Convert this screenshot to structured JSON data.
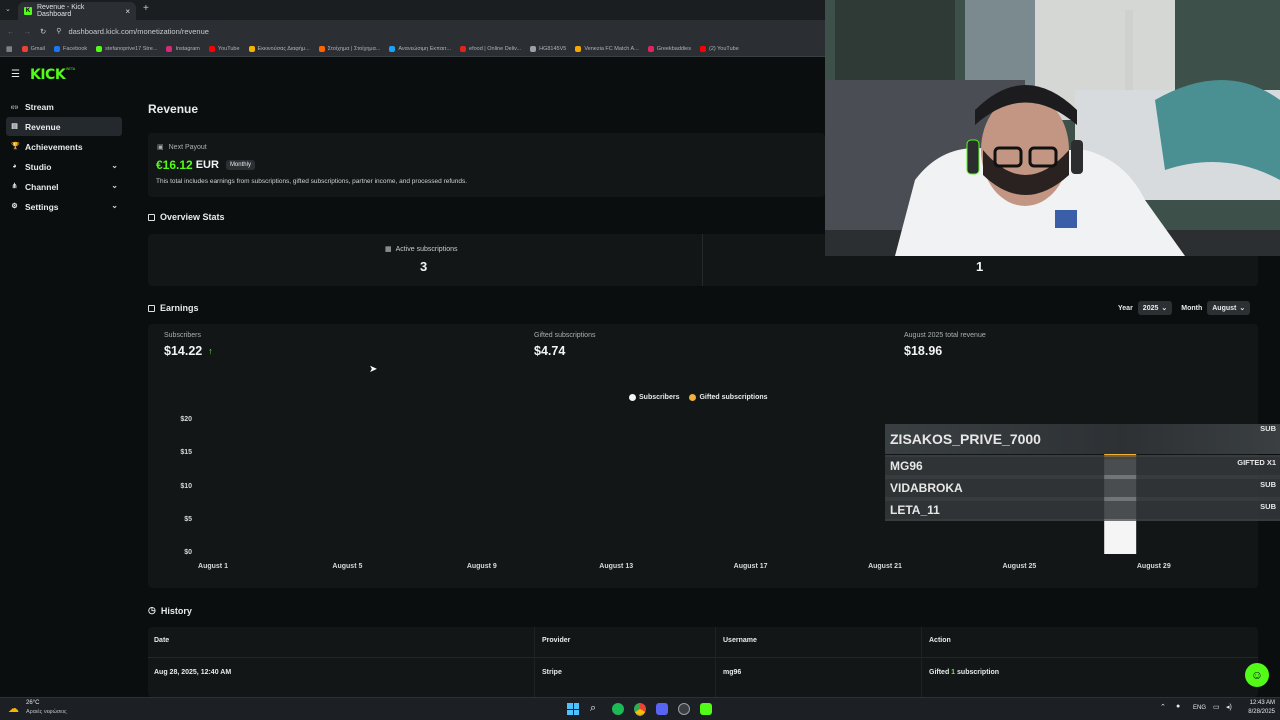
{
  "browser": {
    "tab_title": "Revenue - Kick Dashboard",
    "url": "dashboard.kick.com/monetization/revenue",
    "bookmarks": [
      {
        "label": "Gmail",
        "color": "#ea4335"
      },
      {
        "label": "Facebook",
        "color": "#1877f2"
      },
      {
        "label": "stefanoprive17 Stre...",
        "color": "#53fc18"
      },
      {
        "label": "Instagram",
        "color": "#d62976"
      },
      {
        "label": "YouTube",
        "color": "#ff0000"
      },
      {
        "label": "Εκκινούσας Διαφήμ...",
        "color": "#f4b400"
      },
      {
        "label": "Στοίχημα | Στοίχημα...",
        "color": "#ff6600"
      },
      {
        "label": "Ανανεώσιμη Εκπαιτ...",
        "color": "#1da1f2"
      },
      {
        "label": "efood | Online Deliv...",
        "color": "#e2231a"
      },
      {
        "label": "HG8145V5",
        "color": "#9aa0a6"
      },
      {
        "label": "Venezia FC Match A...",
        "color": "#f7a800"
      },
      {
        "label": "Greekbaddies",
        "color": "#e0245e"
      },
      {
        "label": "(2) YouTube",
        "color": "#ff0000"
      }
    ]
  },
  "sidebar": {
    "logo": "KICK",
    "logo_sup": "BETA",
    "items": [
      {
        "label": "Stream",
        "icon": "broadcast-icon",
        "glyph": "((·))"
      },
      {
        "label": "Revenue",
        "icon": "receipt-icon",
        "glyph": "▤",
        "active": true
      },
      {
        "label": "Achievements",
        "icon": "trophy-icon",
        "glyph": "🏆"
      },
      {
        "label": "Studio",
        "icon": "palette-icon",
        "glyph": "◕",
        "expandable": true
      },
      {
        "label": "Channel",
        "icon": "share-icon",
        "glyph": "⋔",
        "expandable": true
      },
      {
        "label": "Settings",
        "icon": "gear-icon",
        "glyph": "⚙",
        "expandable": true
      }
    ]
  },
  "main": {
    "page_title": "Revenue",
    "payout": {
      "label": "Next Payout",
      "amount": "€16.12",
      "currency": "EUR",
      "badge": "Monthly",
      "note": "This total includes earnings from subscriptions, gifted subscriptions, partner income, and processed refunds."
    },
    "overview": {
      "title": "Overview Stats",
      "active_label": "Active subscriptions",
      "active_value": "3",
      "second_value": "1"
    },
    "earnings": {
      "title": "Earnings",
      "year_label": "Year",
      "year_value": "2025",
      "month_label": "Month",
      "month_value": "August",
      "subscribers_label": "Subscribers",
      "subscribers_value": "$14.22",
      "gifted_label": "Gifted subscriptions",
      "gifted_value": "$4.74",
      "total_label": "August 2025 total revenue",
      "total_value": "$18.96"
    },
    "history": {
      "title": "History",
      "columns": [
        "Date",
        "Provider",
        "Username",
        "Action"
      ],
      "rows": [
        {
          "date": "Aug 28, 2025, 12:40 AM",
          "provider": "Stripe",
          "username": "mg96",
          "action_prefix": "Gifted ",
          "action_count": "1",
          "action_suffix": " subscription"
        }
      ]
    }
  },
  "chart_data": {
    "type": "bar",
    "stacked": true,
    "series": [
      {
        "name": "Subscribers",
        "color": "#f5f5f5",
        "values": [
          {
            "x": "August 28",
            "y": 14.22
          }
        ]
      },
      {
        "name": "Gifted subscriptions",
        "color": "#f0b03a",
        "values": [
          {
            "x": "August 28",
            "y": 4.74
          }
        ]
      }
    ],
    "x_ticks": [
      "August 1",
      "August 5",
      "August 9",
      "August 13",
      "August 17",
      "August 21",
      "August 25",
      "August 29"
    ],
    "y_ticks": [
      "$0",
      "$5",
      "$10",
      "$15",
      "$20"
    ],
    "ylim": [
      0,
      20
    ],
    "legend_position": "top-center"
  },
  "overlay": {
    "rows": [
      {
        "name": "ZISAKOS_PRIVE_7000",
        "tag": "SUB"
      },
      {
        "name": "MG96",
        "tag": "GIFTED X1"
      },
      {
        "name": "VIDABROKA",
        "tag": "SUB"
      },
      {
        "name": "LETA_11",
        "tag": "SUB"
      }
    ]
  },
  "taskbar": {
    "weather_temp": "26°C",
    "weather_desc": "Αραιές νεφώσεις",
    "lang": "ENG",
    "time": "12:43 AM",
    "date": "8/28/2025"
  },
  "colors": {
    "accent": "#53fc18",
    "bg": "#0b0e0f",
    "card": "#121617"
  }
}
